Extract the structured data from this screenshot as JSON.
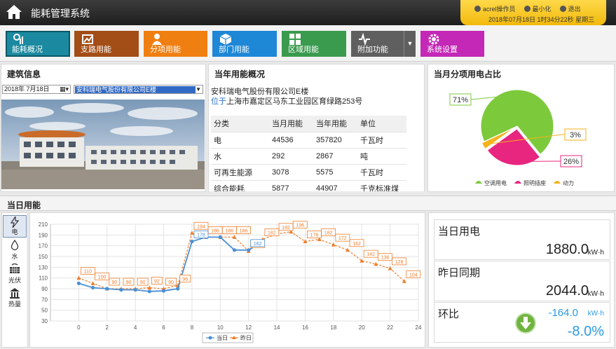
{
  "header": {
    "title": "能耗管理系统",
    "user": "acrel操作员",
    "minimize_label": "最小化",
    "exit_label": "退出",
    "datetime": "2018年07月18日 1时34分22秒 星期三"
  },
  "nav": [
    {
      "label": "能耗概况",
      "color": "#1b8aa0",
      "icon": "overview-icon"
    },
    {
      "label": "支路用能",
      "color": "#a34d17",
      "icon": "branch-icon"
    },
    {
      "label": "分项用能",
      "color": "#f07f12",
      "icon": "user-icon"
    },
    {
      "label": "部门用能",
      "color": "#1e87d6",
      "icon": "box-icon"
    },
    {
      "label": "区域用能",
      "color": "#3a9a4e",
      "icon": "grid-icon"
    },
    {
      "label": "附加功能",
      "color": "#5f5f5f",
      "icon": "pulse-icon"
    },
    {
      "label": "系统设置",
      "color": "#c428b6",
      "icon": "gear-icon"
    }
  ],
  "building": {
    "title": "建筑信息",
    "date": "2018年 7月18日",
    "selected": "安科瑞电气股份有限公司E楼"
  },
  "year": {
    "title": "当年用能概况",
    "company": "安科瑞电气股份有限公司E楼",
    "address_prefix": "位于",
    "address": "上海市嘉定区马东工业园区育绿路253号",
    "headers": [
      "分类",
      "当月用能",
      "当年用能",
      "单位"
    ],
    "rows": [
      [
        "电",
        "44536",
        "357820",
        "千瓦时"
      ],
      [
        "水",
        "292",
        "2867",
        "吨"
      ],
      [
        "可再生能源",
        "3078",
        "5575",
        "千瓦时"
      ],
      [
        "综合能耗",
        "5877",
        "44907",
        "千克标准煤"
      ]
    ]
  },
  "pie": {
    "title": "当月分项用电占比",
    "slices": [
      {
        "name": "空调用电",
        "value": 71,
        "label": "71%",
        "color": "#7dc93c"
      },
      {
        "name": "照明插座",
        "value": 26,
        "label": "26%",
        "color": "#e8257f"
      },
      {
        "name": "动力",
        "value": 3,
        "label": "3%",
        "color": "#f5b21c"
      }
    ]
  },
  "daily": {
    "title": "当日用能",
    "tabs": [
      {
        "label": "电",
        "icon": "lightning-icon"
      },
      {
        "label": "水",
        "icon": "water-drop-icon"
      },
      {
        "label": "光伏",
        "icon": "solar-icon"
      },
      {
        "label": "热量",
        "icon": "heat-icon"
      }
    ]
  },
  "chart_data": {
    "type": "line",
    "x": [
      0,
      1,
      2,
      3,
      4,
      5,
      6,
      7,
      8,
      9,
      10,
      11,
      12,
      13,
      14,
      15,
      16,
      17,
      18,
      19,
      20,
      21,
      22,
      23
    ],
    "xlim": [
      -2,
      24
    ],
    "ylim": [
      30,
      210
    ],
    "x_ticks": [
      0,
      2,
      4,
      6,
      8,
      10,
      12,
      14,
      16,
      18,
      20,
      22,
      24
    ],
    "y_ticks": [
      30,
      50,
      70,
      90,
      110,
      130,
      150,
      170,
      190,
      210
    ],
    "series": [
      {
        "name": "当日",
        "color": "#4a8fd4",
        "marker": "circle",
        "values": [
          100,
          92,
          90,
          88,
          88,
          85,
          86,
          90,
          178,
          186,
          186,
          162,
          162,
          178
        ],
        "labels": {
          "8": "178",
          "12": "162"
        }
      },
      {
        "name": "昨日",
        "color": "#ef7d2b",
        "marker": "triangle",
        "values": [
          110,
          100,
          90,
          90,
          90,
          92,
          90,
          96,
          194,
          186,
          186,
          186,
          160,
          182,
          192,
          196,
          178,
          182,
          172,
          162,
          142,
          136,
          128,
          104
        ],
        "labels": {
          "0": "110",
          "1": "100",
          "2": "90",
          "3": "90",
          "4": "90",
          "5": "92",
          "6": "90",
          "7": "96",
          "8": "194",
          "9": "186",
          "10": "186",
          "11": "186",
          "12": "160",
          "13": "182",
          "14": "192",
          "15": "196",
          "16": "178",
          "17": "182",
          "18": "172",
          "19": "162",
          "20": "142",
          "21": "136",
          "22": "128",
          "23": "104"
        }
      }
    ]
  },
  "kpis": {
    "today": {
      "label": "当日用电",
      "value": "1880.0",
      "unit": "kW·h"
    },
    "yesterday": {
      "label": "昨日同期",
      "value": "2044.0",
      "unit": "kW·h"
    },
    "ratio": {
      "label": "环比",
      "diff": "-164.0",
      "unit": "kW·h",
      "percent": "-8.0%"
    }
  }
}
